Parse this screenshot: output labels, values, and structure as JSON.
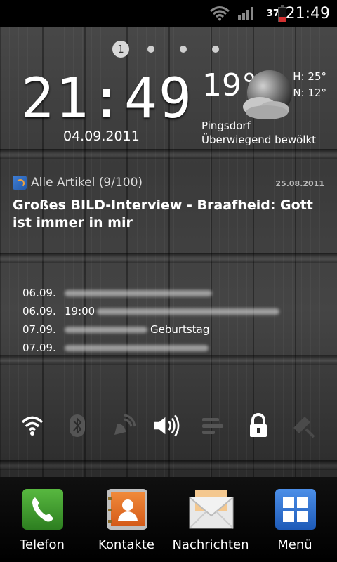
{
  "status_bar": {
    "time": "21:49",
    "battery_level": "37",
    "icons": [
      "wifi-icon",
      "signal-icon",
      "battery-icon"
    ]
  },
  "home": {
    "pager": {
      "active": "1",
      "total": 4
    },
    "clock": {
      "time": "21:49",
      "date": "04.09.2011"
    },
    "weather": {
      "temperature": "19°",
      "high": "H: 25°",
      "low": "N: 12°",
      "location": "Pingsdorf",
      "condition": "Überwiegend bewölkt"
    },
    "news": {
      "feed": "Alle Artikel (9/100)",
      "date": "25.08.2011",
      "title": "Großes BILD-Interview - Braafheid: Gott ist immer in mir"
    },
    "calendar": [
      {
        "date": "06.09.",
        "time": "",
        "tag": ""
      },
      {
        "date": "06.09.",
        "time": "19:00",
        "tag": ""
      },
      {
        "date": "07.09.",
        "time": "",
        "tag": "Geburtstag"
      },
      {
        "date": "07.09.",
        "time": "",
        "tag": ""
      }
    ],
    "toggles": [
      "wifi-toggle",
      "bluetooth-toggle",
      "gps-toggle",
      "sound-toggle",
      "sync-toggle",
      "lock-toggle",
      "brightness-toggle"
    ]
  },
  "dock": [
    {
      "label": "Telefon",
      "icon": "phone-icon"
    },
    {
      "label": "Kontakte",
      "icon": "contacts-icon"
    },
    {
      "label": "Nachrichten",
      "icon": "messages-icon"
    },
    {
      "label": "Menü",
      "icon": "menu-icon"
    }
  ],
  "colors": {
    "battery_low": "#d23030",
    "phone_green": "#3a9a2a",
    "contacts_orange": "#e0702a",
    "menu_blue": "#2a6fd0"
  }
}
